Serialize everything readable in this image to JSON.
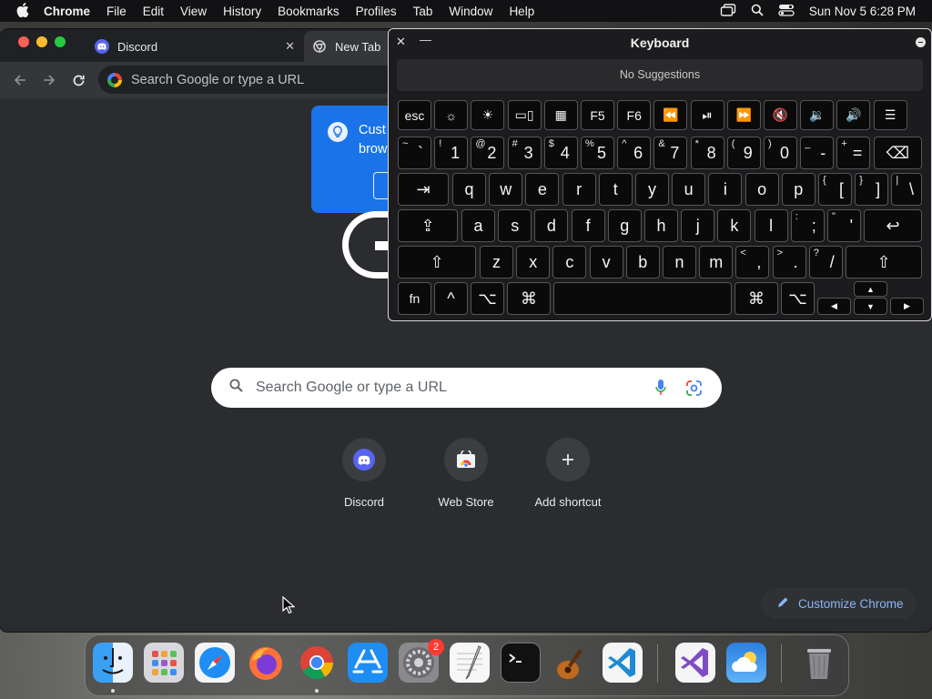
{
  "menubar": {
    "app_name": "Chrome",
    "items": [
      "File",
      "Edit",
      "View",
      "History",
      "Bookmarks",
      "Profiles",
      "Tab",
      "Window",
      "Help"
    ],
    "clock": "Sun Nov 5  6:28 PM",
    "icons": [
      "stage-manager-icon",
      "spotlight-icon",
      "control-center-icon"
    ]
  },
  "browser": {
    "tabs": [
      {
        "title": "Discord",
        "icon": "discord-icon"
      },
      {
        "title": "New Tab",
        "icon": "chrome-icon"
      }
    ],
    "omnibox_placeholder": "Search Google or type a URL"
  },
  "new_tab_page": {
    "promo_text_line1": "Cust",
    "promo_text_line2": "brow",
    "search_placeholder": "Search Google or type a URL",
    "shortcuts": [
      {
        "label": "Discord",
        "icon": "discord-icon"
      },
      {
        "label": "Web Store",
        "icon": "web-store-icon"
      },
      {
        "label": "Add shortcut",
        "icon": "plus-icon"
      }
    ],
    "customize_label": "Customize Chrome"
  },
  "keyboard_viewer": {
    "title": "Keyboard",
    "suggestions": "No Suggestions",
    "rows": [
      [
        {
          "main": "esc"
        },
        {
          "main": "☼"
        },
        {
          "main": "☀"
        },
        {
          "main": "▭▯"
        },
        {
          "main": "▦"
        },
        {
          "main": "F5"
        },
        {
          "main": "F6"
        },
        {
          "main": "⏪"
        },
        {
          "main": "⏯"
        },
        {
          "main": "⏩"
        },
        {
          "main": "🔇"
        },
        {
          "main": "🔉"
        },
        {
          "main": "🔊"
        },
        {
          "main": "☰"
        }
      ],
      [
        {
          "sub": "~",
          "main": "`"
        },
        {
          "sub": "!",
          "main": "1"
        },
        {
          "sub": "@",
          "main": "2"
        },
        {
          "sub": "#",
          "main": "3"
        },
        {
          "sub": "$",
          "main": "4"
        },
        {
          "sub": "%",
          "main": "5"
        },
        {
          "sub": "^",
          "main": "6"
        },
        {
          "sub": "&",
          "main": "7"
        },
        {
          "sub": "*",
          "main": "8"
        },
        {
          "sub": "(",
          "main": "9"
        },
        {
          "sub": ")",
          "main": "0"
        },
        {
          "sub": "_",
          "main": "-"
        },
        {
          "sub": "+",
          "main": "="
        },
        {
          "main": "⌫"
        }
      ],
      [
        {
          "main": "⇥"
        },
        {
          "main": "q"
        },
        {
          "main": "w"
        },
        {
          "main": "e"
        },
        {
          "main": "r"
        },
        {
          "main": "t"
        },
        {
          "main": "y"
        },
        {
          "main": "u"
        },
        {
          "main": "i"
        },
        {
          "main": "o"
        },
        {
          "main": "p"
        },
        {
          "sub": "{",
          "main": "["
        },
        {
          "sub": "}",
          "main": "]"
        },
        {
          "sub": "|",
          "main": "\\"
        }
      ],
      [
        {
          "main": "⇪"
        },
        {
          "main": "a"
        },
        {
          "main": "s"
        },
        {
          "main": "d"
        },
        {
          "main": "f"
        },
        {
          "main": "g"
        },
        {
          "main": "h"
        },
        {
          "main": "j"
        },
        {
          "main": "k"
        },
        {
          "main": "l"
        },
        {
          "sub": ":",
          "main": ";"
        },
        {
          "sub": "\"",
          "main": "'"
        },
        {
          "main": "↩"
        }
      ],
      [
        {
          "main": "⇧"
        },
        {
          "main": "z"
        },
        {
          "main": "x"
        },
        {
          "main": "c"
        },
        {
          "main": "v"
        },
        {
          "main": "b"
        },
        {
          "main": "n"
        },
        {
          "main": "m"
        },
        {
          "sub": "<",
          "main": ","
        },
        {
          "sub": ">",
          "main": "."
        },
        {
          "sub": "?",
          "main": "/"
        },
        {
          "main": "⇧"
        }
      ],
      [
        {
          "main": "fn"
        },
        {
          "main": "^"
        },
        {
          "main": "⌥"
        },
        {
          "main": "⌘"
        },
        {
          "main": ""
        },
        {
          "main": "⌘"
        },
        {
          "main": "⌥"
        },
        {
          "main": "◀"
        },
        {
          "main": "▲"
        },
        {
          "main": "▼"
        },
        {
          "main": "▶"
        }
      ]
    ]
  },
  "dock": {
    "apps": [
      {
        "name": "Finder",
        "icon": "finder-icon",
        "running": true
      },
      {
        "name": "Launchpad",
        "icon": "launchpad-icon"
      },
      {
        "name": "Safari",
        "icon": "safari-icon"
      },
      {
        "name": "Firefox",
        "icon": "firefox-icon"
      },
      {
        "name": "Chrome",
        "icon": "chrome-icon",
        "running": true
      },
      {
        "name": "App Store",
        "icon": "app-store-icon"
      },
      {
        "name": "System Settings",
        "icon": "settings-icon",
        "badge": "2"
      },
      {
        "name": "TextEdit",
        "icon": "textedit-icon"
      },
      {
        "name": "Terminal",
        "icon": "terminal-icon"
      },
      {
        "name": "GarageBand",
        "icon": "garageband-icon"
      },
      {
        "name": "Visual Studio Code",
        "icon": "vscode-icon"
      },
      {
        "name": "Visual Studio",
        "icon": "visual-studio-icon"
      },
      {
        "name": "Weather",
        "icon": "weather-icon"
      },
      {
        "name": "Trash",
        "icon": "trash-icon"
      }
    ]
  }
}
